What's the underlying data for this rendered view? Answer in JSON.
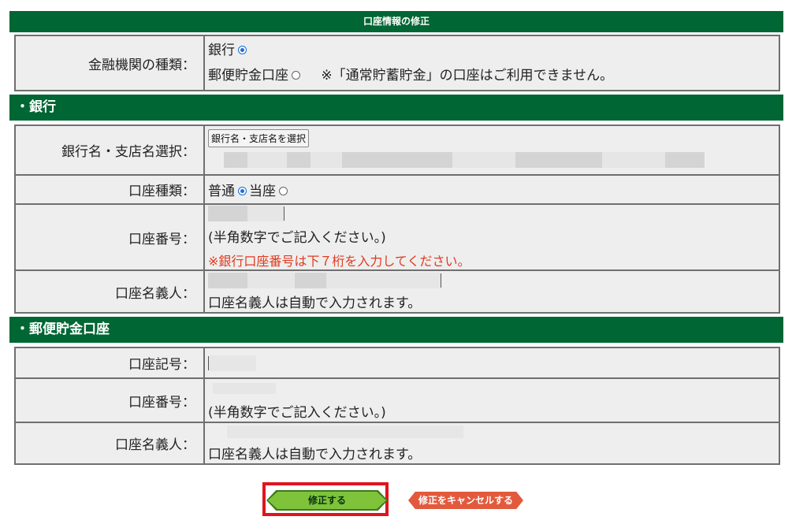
{
  "form_title": "口座情報の修正",
  "institution": {
    "label": "金融機関の種類：",
    "option_bank": "銀行",
    "option_postal": "郵便貯金口座",
    "postal_note": "※「通常貯蓄貯金」の口座はご利用できません。"
  },
  "bank_section": {
    "header": "・銀行",
    "branch_label": "銀行名・支店名選択：",
    "branch_button": "銀行名・支店名を選択",
    "type_label": "口座種類：",
    "type_futsu": "普通",
    "type_touza": "当座",
    "number_label": "口座番号：",
    "number_hint": "(半角数字でご記入ください。)",
    "number_warning": "※銀行口座番号は下７桁を入力してください。",
    "holder_label": "口座名義人：",
    "holder_hint": "口座名義人は自動で入力されます。"
  },
  "postal_section": {
    "header": "・郵便貯金口座",
    "symbol_label": "口座記号：",
    "number_label": "口座番号：",
    "number_hint": "(半角数字でご記入ください。)",
    "holder_label": "口座名義人：",
    "holder_hint": "口座名義人は自動で入力されます。"
  },
  "buttons": {
    "submit": "修正する",
    "cancel": "修正をキャンセルする"
  },
  "colors": {
    "header_green": "#006633",
    "submit_green": "#7ec33a",
    "cancel_red": "#e25a3d",
    "highlight_red": "#e0141e",
    "warning_red": "#e03a1e"
  }
}
